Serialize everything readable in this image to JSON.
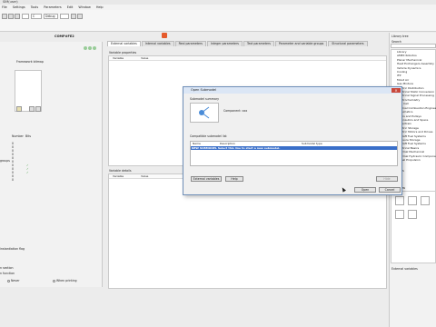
{
  "window": {
    "title": "SIM(user)"
  },
  "menu": [
    "File",
    "Settings",
    "Tools",
    "Parameters",
    "Edit",
    "Window",
    "Help"
  ],
  "toolbar": {
    "combo1": "",
    "combo2": "C",
    "combo3": "Debug",
    "combo4": ""
  },
  "component": {
    "title": "COMP#FE2"
  },
  "left_panel": {
    "bitmap_label": "Framework bitmap",
    "table_headers": [
      "Number",
      "Bits"
    ],
    "groups_label": "groups",
    "rows": [
      "0",
      "0",
      "0",
      "0",
      "0",
      "0",
      "0",
      "0",
      "0",
      "0",
      "0"
    ],
    "line_flag": "instantiation flag",
    "line_section": "n section",
    "line_function": "n function",
    "radio_never": "Never",
    "radio_printing": "When printing"
  },
  "tabs": [
    {
      "label": "External variables",
      "active": true
    },
    {
      "label": "Internal variables"
    },
    {
      "label": "Real parameters"
    },
    {
      "label": "Integer parameters"
    },
    {
      "label": "Text parameters"
    },
    {
      "label": "Parameter and variable groups"
    },
    {
      "label": "Structural parameters"
    }
  ],
  "grids": {
    "top_label": "Variable properties",
    "top_headers": [
      "Variable",
      "Value"
    ],
    "bottom_label": "Variable details",
    "bottom_headers": [
      "Variable",
      "Value"
    ]
  },
  "dialog": {
    "title": "Open Submodel",
    "summary_label": "Submodel summary",
    "component_name": "Component: xxx",
    "list_label": "Compatible submodel list",
    "headers": [
      "Name",
      "Description",
      "Submodel type"
    ],
    "selected_row": "NEW SUBMODEL   Select this line to start a new submodel.",
    "btn_external": "External variables",
    "btn_help": "Help",
    "btn_hide": "Hide",
    "btn_open": "Open",
    "btn_cancel": "Cancel"
  },
  "library": {
    "title": "Library tree",
    "search": "Search",
    "items": [
      "Library",
      "AMEX Robotos",
      "Planar Mechanical",
      "Heat Exchangers Assembly",
      "Vehicle Dynamics",
      "Cooling",
      "IFP",
      "Moist Air",
      "Gas Mixture",
      "Electric Distribution",
      "Electrical Static Conversion",
      "Electrical Signal Processing",
      "Electrochemistry",
      "Fuel Cell",
      "Internal Combustion Engines",
      "Pneumatics",
      "Gears and Pulleys",
      "Aeronautics and Space",
      "Powertrain",
      "Electric Storage",
      "Electric Motors and Drives",
      "Aircraft Fuel Systems",
      "Pressure Storage",
      "Aircraft Fuel Systems",
      "Electrical Basics",
      "Thermal Mechanical",
      "Thermal Hydraulic Components",
      "Signal Propulsion"
    ],
    "list_label": "Libraries",
    "panel_label": "Overview",
    "ext_label": "External variables"
  },
  "accent": "#3a6fc9",
  "desktop": "#4a7fc3"
}
